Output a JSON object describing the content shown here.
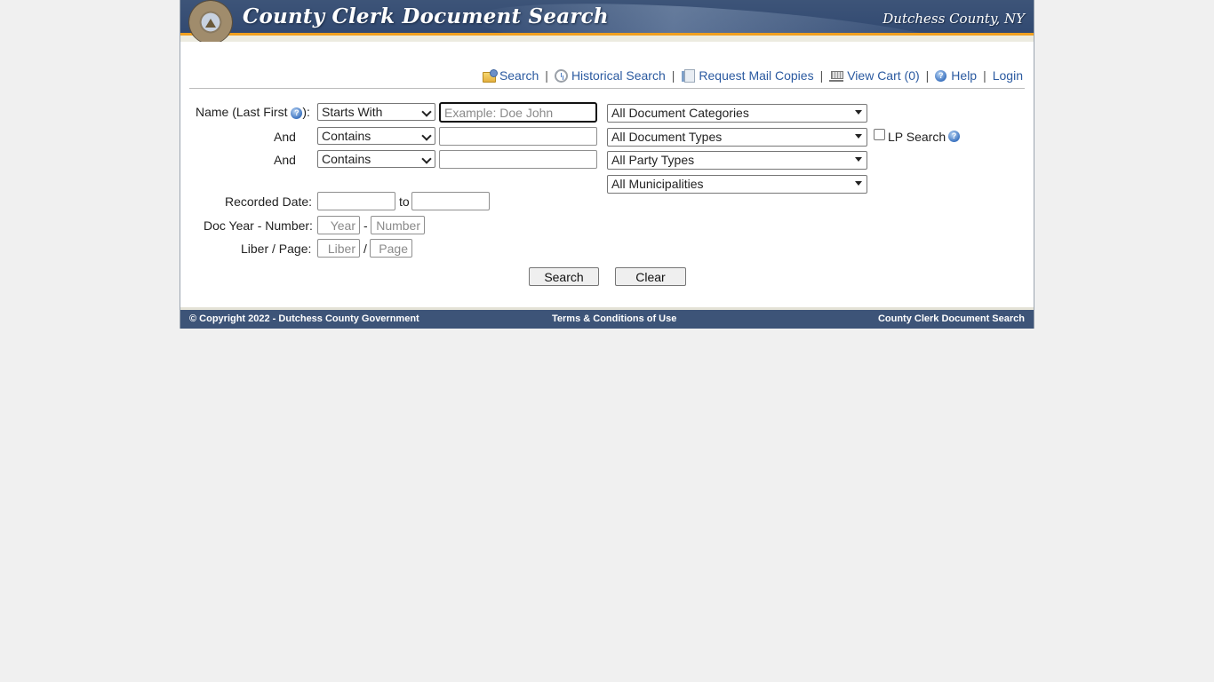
{
  "header": {
    "site_title": "County Clerk Document Search",
    "county_name": "Dutchess County, NY",
    "logo_icon": "county-seal-icon"
  },
  "nav": {
    "items": [
      {
        "label": "Search",
        "icon": "folder-search-icon"
      },
      {
        "label": "Historical Search",
        "icon": "clock-icon"
      },
      {
        "label": "Request Mail Copies",
        "icon": "document-icon"
      },
      {
        "label": "View Cart (0)",
        "icon": "cart-icon"
      },
      {
        "label": "Help",
        "icon": "help-icon"
      },
      {
        "label": "Login",
        "icon": ""
      }
    ],
    "separator": "|"
  },
  "form": {
    "name_label": "Name (Last First",
    "name_label_suffix": "):",
    "name_help_icon": "?",
    "and_label": "And",
    "name_rows": [
      {
        "match": "Starts With",
        "value": "",
        "placeholder": "Example: Doe John"
      },
      {
        "match": "Contains",
        "value": "",
        "placeholder": ""
      },
      {
        "match": "Contains",
        "value": "",
        "placeholder": ""
      }
    ],
    "match_options": [
      "Starts With",
      "Contains"
    ],
    "category": "All Document Categories",
    "doc_type": "All Document Types",
    "party_type": "All Party Types",
    "municipality": "All Municipalities",
    "lp_search_label": "LP Search",
    "lp_search_checked": false,
    "recorded_date_label": "Recorded Date:",
    "date_from": "",
    "date_to_label": "to",
    "date_to": "",
    "doc_year_label": "Doc Year - Number:",
    "year_placeholder": "Year",
    "year_sep": "-",
    "number_placeholder": "Number",
    "liber_label": "Liber / Page:",
    "liber_placeholder": "Liber",
    "liber_sep": "/",
    "page_placeholder": "Page",
    "search_button": "Search",
    "clear_button": "Clear"
  },
  "footer": {
    "copyright": "© Copyright 2022 - Dutchess County Government",
    "terms": "Terms & Conditions of Use",
    "app_name": "County Clerk Document Search"
  },
  "colors": {
    "banner": "#3d5478",
    "accent_gold": "#f0a020",
    "link": "#2b5aa0",
    "page_bg": "#f0f0f0"
  }
}
